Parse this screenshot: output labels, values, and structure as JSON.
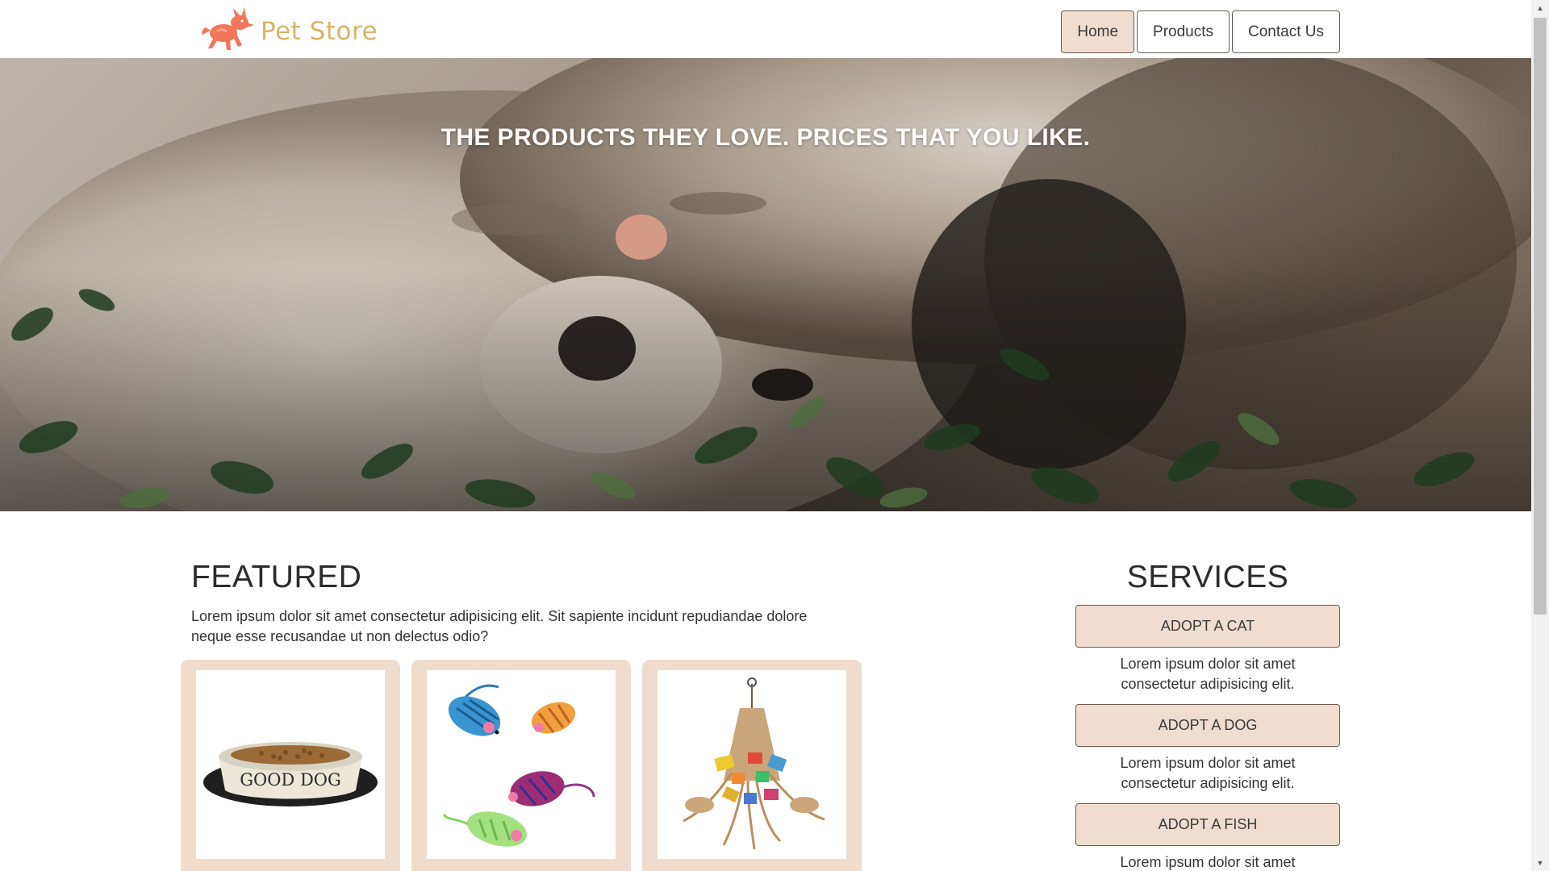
{
  "header": {
    "brand": "Pet Store",
    "nav": [
      {
        "label": "Home"
      },
      {
        "label": "Products"
      },
      {
        "label": "Contact Us"
      }
    ]
  },
  "hero": {
    "tagline": "THE PRODUCTS THEY LOVE. PRICES THAT YOU LIKE."
  },
  "featured": {
    "title": "FEATURED",
    "description": "Lorem ipsum dolor sit amet consectetur adipisicing elit. Sit sapiente incidunt repudiandae dolore neque esse recusandae ut non delectus odio?",
    "products": [
      {
        "bowl_text": "GOOD DOG"
      },
      {
        "icon": "toy-mice"
      },
      {
        "icon": "bird-toy"
      }
    ]
  },
  "services": {
    "title": "SERVICES",
    "items": [
      {
        "label": "ADOPT A CAT",
        "description": "Lorem ipsum dolor sit amet consectetur adipisicing elit."
      },
      {
        "label": "ADOPT A DOG",
        "description": "Lorem ipsum dolor sit amet consectetur adipisicing elit."
      },
      {
        "label": "ADOPT A FISH",
        "description": "Lorem ipsum dolor sit amet consectetur adipisicing elit."
      }
    ]
  },
  "colors": {
    "accent": "#f0ddd0",
    "card": "#efdccd",
    "logo_dog": "#f0775a",
    "logo_text": "#d9b36a",
    "border": "#6b5a50"
  }
}
